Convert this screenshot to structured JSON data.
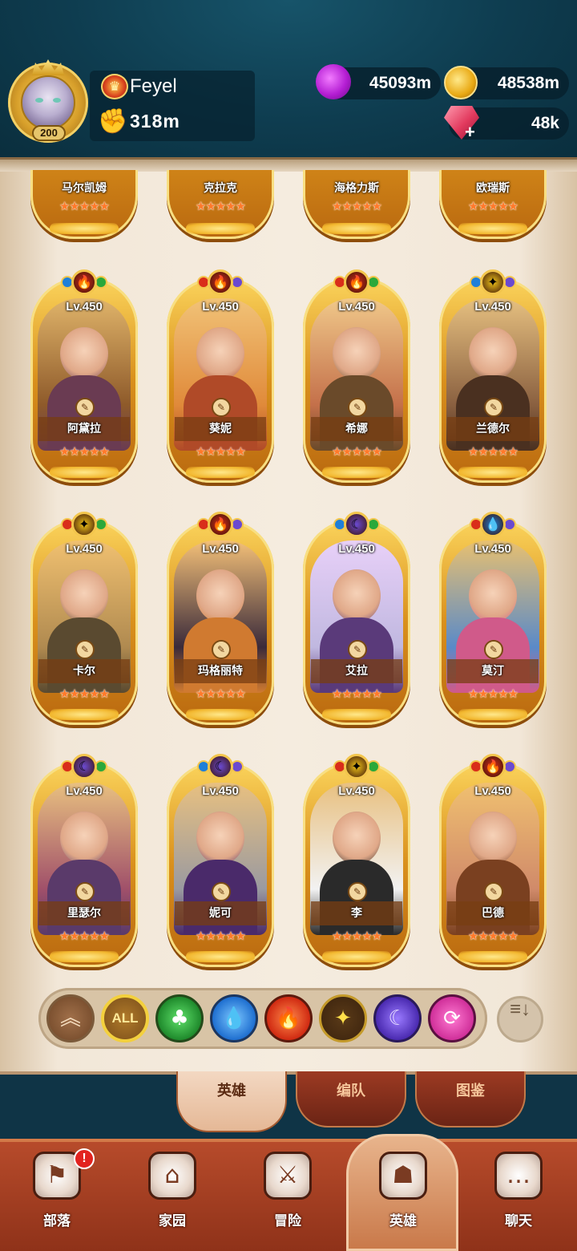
{
  "player": {
    "name": "Feyel",
    "level": "200",
    "power": "318m"
  },
  "resources": {
    "elixir": "45093m",
    "gold": "48538m",
    "gems": "48k"
  },
  "top_row_heroes": [
    {
      "name": "马尔凯姆",
      "stars": "★★★★★"
    },
    {
      "name": "克拉克",
      "stars": "★★★★★"
    },
    {
      "name": "海格力斯",
      "stars": "★★★★★"
    },
    {
      "name": "欧瑞斯",
      "stars": "★★★★★"
    }
  ],
  "heroes": [
    {
      "name": "阿黛拉",
      "level": "Lv.450",
      "stars": "★★★★★",
      "element": "fire"
    },
    {
      "name": "葵妮",
      "level": "Lv.450",
      "stars": "★★★★★",
      "element": "fire"
    },
    {
      "name": "希娜",
      "level": "Lv.450",
      "stars": "★★★★★",
      "element": "fire"
    },
    {
      "name": "兰德尔",
      "level": "Lv.450",
      "stars": "★★★★★",
      "element": "light"
    },
    {
      "name": "卡尔",
      "level": "Lv.450",
      "stars": "★★★★★",
      "element": "light"
    },
    {
      "name": "玛格丽特",
      "level": "Lv.450",
      "stars": "★★★★★",
      "element": "fire"
    },
    {
      "name": "艾拉",
      "level": "Lv.450",
      "stars": "★★★★★",
      "element": "dark"
    },
    {
      "name": "莫汀",
      "level": "Lv.450",
      "stars": "★★★★★",
      "element": "water"
    },
    {
      "name": "里瑟尔",
      "level": "Lv.450",
      "stars": "★★★★★",
      "element": "dark"
    },
    {
      "name": "妮可",
      "level": "Lv.450",
      "stars": "★★★★★",
      "element": "dark"
    },
    {
      "name": "李",
      "level": "Lv.450",
      "stars": "★★★★★",
      "element": "light"
    },
    {
      "name": "巴德",
      "level": "Lv.450",
      "stars": "★★★★★",
      "element": "fire"
    }
  ],
  "filters": {
    "all_label": "ALL",
    "items": [
      "collapse",
      "all",
      "nature",
      "water",
      "fire",
      "light",
      "dark",
      "chaos"
    ]
  },
  "sort_label": "≡↓",
  "subtabs": [
    {
      "label": "英雄",
      "active": true
    },
    {
      "label": "编队",
      "active": false
    },
    {
      "label": "图鉴",
      "active": false
    }
  ],
  "nav": [
    {
      "label": "部落",
      "icon": "tribe-icon",
      "badge": "!"
    },
    {
      "label": "家园",
      "icon": "home-icon"
    },
    {
      "label": "冒险",
      "icon": "swords-icon"
    },
    {
      "label": "英雄",
      "icon": "hero-helmet-icon",
      "active": true
    },
    {
      "label": "聊天",
      "icon": "chat-icon"
    }
  ],
  "colors": {
    "header_bg": "#0e3c4f",
    "card_gold": "#d9901c",
    "fire": "#d92d1a",
    "water": "#1f7fd8",
    "nature": "#2aa83a",
    "light": "#f0c419",
    "dark": "#6a4ad0",
    "chaos": "#e0349a",
    "nav_bg": "#b74b2b"
  }
}
